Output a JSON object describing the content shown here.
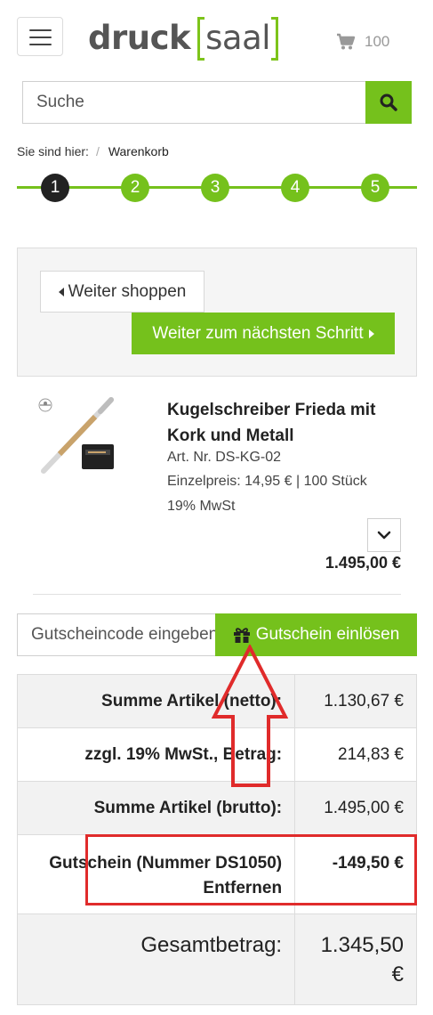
{
  "header": {
    "logo_part1": "druck",
    "logo_part2": "saal",
    "cart_count": "100"
  },
  "search": {
    "placeholder": "Suche"
  },
  "breadcrumb": {
    "prefix": "Sie sind hier:",
    "separator": "/",
    "current": "Warenkorb"
  },
  "steps": [
    "1",
    "2",
    "3",
    "4",
    "5"
  ],
  "actions": {
    "back_label": "Weiter shoppen",
    "next_label": "Weiter zum nächsten Schritt"
  },
  "product": {
    "title": "Kugelschreiber Frieda mit Kork und Metall",
    "article_no": "Art. Nr. DS-KG-02",
    "unit_price": "Einzelpreis: 14,95 € | 100 Stück",
    "vat": "19% MwSt",
    "price": "1.495,00 €"
  },
  "voucher": {
    "placeholder": "Gutscheincode eingeben",
    "button_label": "Gutschein einlösen"
  },
  "totals": {
    "net_label": "Summe Artikel (netto):",
    "net_value": "1.130,67 €",
    "vat_label": "zzgl. 19% MwSt., Betrag:",
    "vat_value": "214,83 €",
    "gross_label": "Summe Artikel (brutto):",
    "gross_value": "1.495,00 €",
    "voucher_name": "Gutschein",
    "voucher_number": "(Nummer DS1050)",
    "voucher_remove": "Entfernen",
    "voucher_value": "-149,50 €",
    "grand_label": "Gesamtbetrag:",
    "grand_value": "1.345,50 €"
  },
  "colors": {
    "accent": "#75c11c",
    "annotation": "#e02b2b"
  },
  "icons": {
    "menu": "hamburger-icon",
    "cart": "cart-icon",
    "search": "search-icon",
    "gift": "gift-icon",
    "chevron": "chevron-down-icon"
  }
}
